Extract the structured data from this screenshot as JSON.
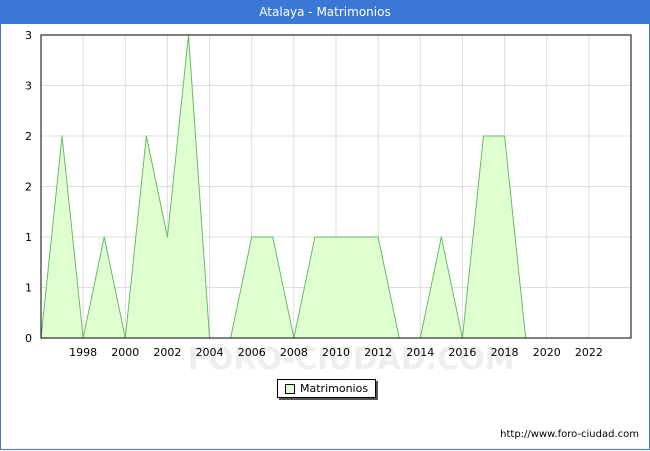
{
  "title": "Atalaya - Matrimonios",
  "watermark": "FORO-CIUDAD.COM",
  "source": "http://www.foro-ciudad.com",
  "colors": {
    "header": "#3a78d8",
    "fill": "#e0ffd0",
    "line": "#66bb66",
    "grid": "#dddddd"
  },
  "chart_data": {
    "type": "area",
    "title": "Atalaya - Matrimonios",
    "xlabel": "",
    "ylabel": "",
    "xlim": [
      1996,
      2024
    ],
    "ylim": [
      0,
      3
    ],
    "x_ticks": [
      "1998",
      "2000",
      "2002",
      "2004",
      "2006",
      "2008",
      "2010",
      "2012",
      "2014",
      "2016",
      "2018",
      "2020",
      "2022"
    ],
    "y_ticks": [
      "0",
      "1",
      "1",
      "2",
      "2",
      "3",
      "3"
    ],
    "grid": true,
    "legend_position": "bottom-center",
    "series": [
      {
        "name": "Matrimonios",
        "x": [
          1996,
          1997,
          1998,
          1999,
          2000,
          2001,
          2002,
          2003,
          2004,
          2005,
          2006,
          2007,
          2008,
          2009,
          2010,
          2011,
          2012,
          2013,
          2014,
          2015,
          2016,
          2017,
          2018,
          2019,
          2020,
          2021,
          2022,
          2023
        ],
        "values": [
          0,
          2,
          0,
          1,
          0,
          2,
          1,
          3,
          0,
          0,
          1,
          1,
          0,
          1,
          1,
          1,
          1,
          0,
          0,
          1,
          0,
          2,
          2,
          0,
          0,
          0,
          0,
          0
        ]
      }
    ]
  }
}
